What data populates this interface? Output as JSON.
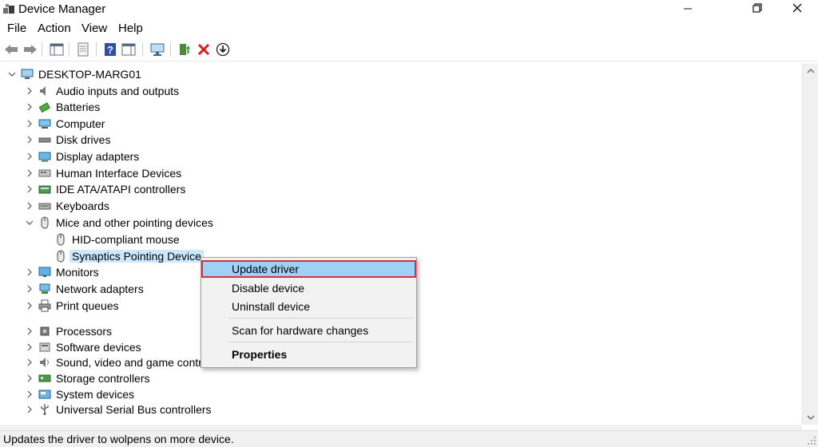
{
  "window": {
    "title": "Device Manager"
  },
  "menubar": [
    "File",
    "Action",
    "View",
    "Help"
  ],
  "tree": {
    "root": "DESKTOP-MARG01",
    "categories": [
      {
        "label": "Audio inputs and outputs",
        "icon": "speaker-icon"
      },
      {
        "label": "Batteries",
        "icon": "battery-icon"
      },
      {
        "label": "Computer",
        "icon": "computer-icon"
      },
      {
        "label": "Disk drives",
        "icon": "disk-drive-icon"
      },
      {
        "label": "Display adapters",
        "icon": "display-adapter-icon"
      },
      {
        "label": "Human Interface Devices",
        "icon": "hid-icon"
      },
      {
        "label": "IDE ATA/ATAPI controllers",
        "icon": "ide-controller-icon"
      },
      {
        "label": "Keyboards",
        "icon": "keyboard-icon"
      },
      {
        "label": "Mice and other pointing devices",
        "icon": "mouse-icon",
        "expanded": true,
        "children": [
          {
            "label": "HID-compliant mouse",
            "icon": "mouse-icon"
          },
          {
            "label": "Synaptics Pointing Device",
            "icon": "mouse-icon",
            "selected": true
          }
        ]
      },
      {
        "label": "Monitors",
        "icon": "monitor-icon"
      },
      {
        "label": "Network adapters",
        "icon": "network-adapter-icon"
      },
      {
        "label": "Print queues",
        "icon": "printer-icon"
      },
      {
        "label": "Processors",
        "icon": "processor-icon"
      },
      {
        "label": "Software devices",
        "icon": "software-device-icon"
      },
      {
        "label": "Sound, video and game controllers",
        "icon": "sound-controller-icon"
      },
      {
        "label": "Storage controllers",
        "icon": "storage-controller-icon"
      },
      {
        "label": "System devices",
        "icon": "system-device-icon"
      },
      {
        "label": "Universal Serial Bus controllers",
        "icon": "usb-icon"
      }
    ]
  },
  "context_menu": {
    "items": [
      {
        "label": "Update driver",
        "highlighted": true
      },
      {
        "label": "Disable device"
      },
      {
        "label": "Uninstall device"
      },
      {
        "label": "Scan for hardware changes"
      },
      {
        "label": "Properties",
        "bold": true
      }
    ]
  },
  "statusbar": {
    "text": "Updates the driver to wolpens on more device."
  },
  "colors": {
    "selection": "#cce8ff",
    "menu_highlight": "#9fd1f4",
    "highlight_border": "#d6313a"
  }
}
